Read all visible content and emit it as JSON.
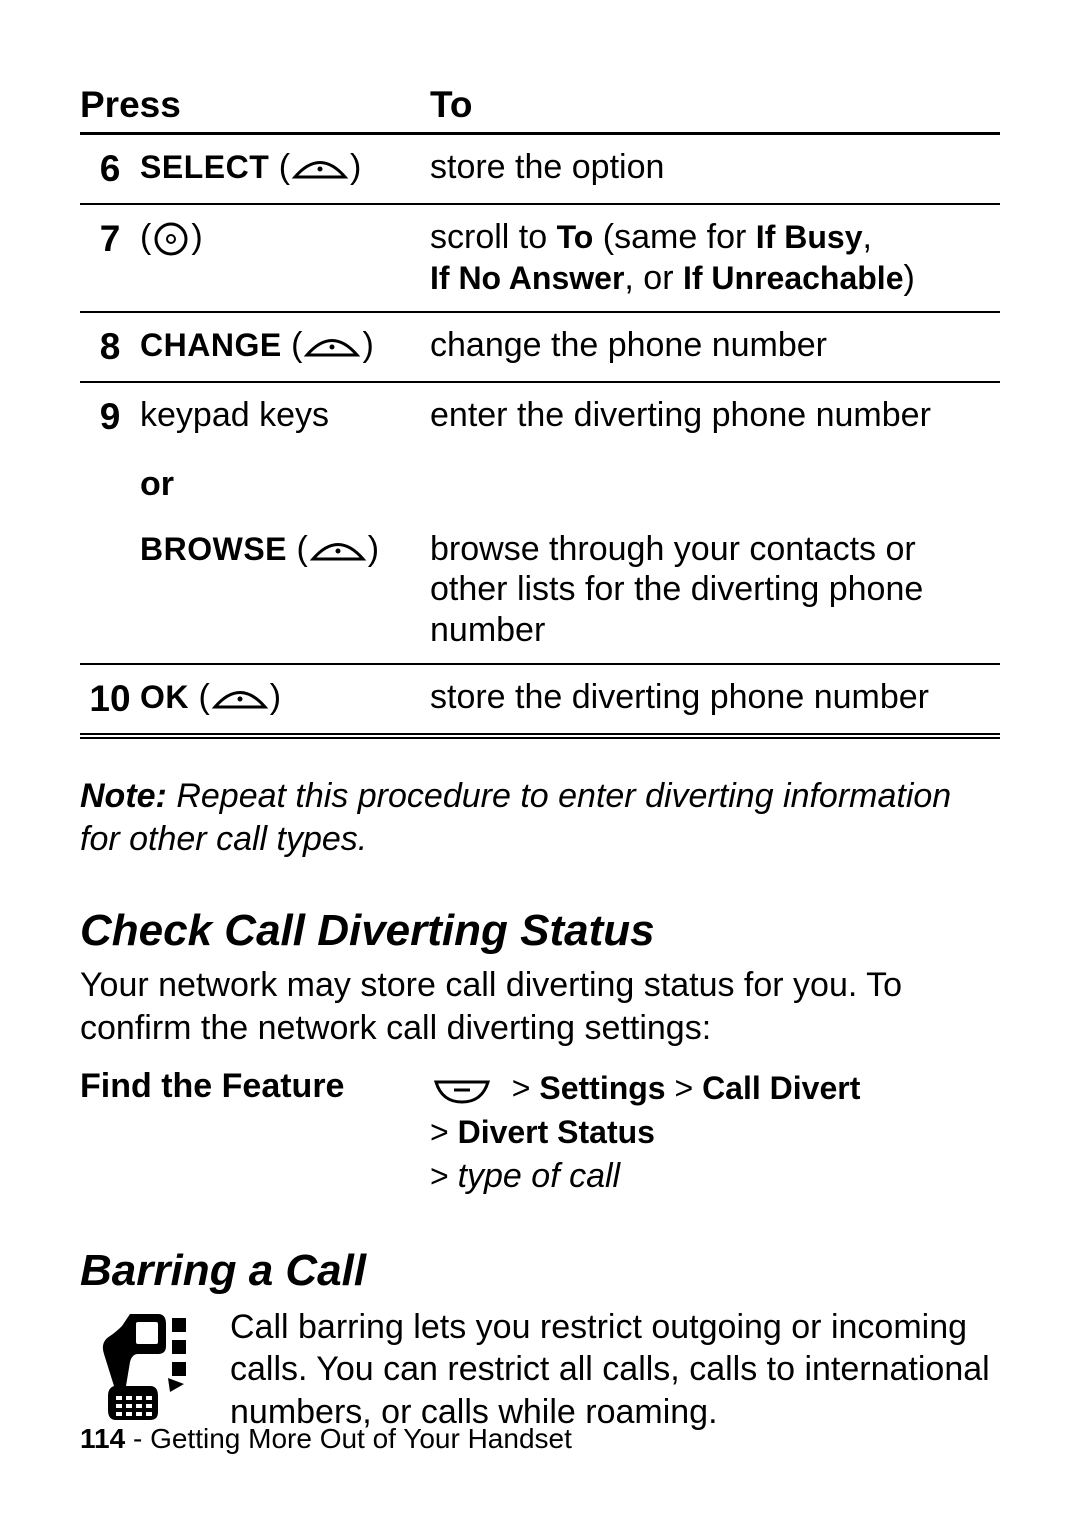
{
  "table": {
    "head_press": "Press",
    "head_to": "To",
    "rows": {
      "r6": {
        "num": "6",
        "press_label": "SELECT",
        "to": "store the option"
      },
      "r7": {
        "num": "7",
        "to_pre": "scroll to ",
        "to_bold1": "To",
        "to_mid1": " (same for ",
        "to_bold2": "If Busy",
        "to_mid2": ", ",
        "to_bold3": "If No Answer",
        "to_mid3": ", or ",
        "to_bold4": "If Unreachable",
        "to_post": ")"
      },
      "r8": {
        "num": "8",
        "press_label": "CHANGE",
        "to": "change the phone number"
      },
      "r9a": {
        "num": "9",
        "press_label": "keypad keys",
        "to": "enter the diverting phone number"
      },
      "r9or": {
        "or": "or"
      },
      "r9b": {
        "press_label": "BROWSE",
        "to": "browse through your contacts or other lists for the diverting phone number"
      },
      "r10": {
        "num": "10",
        "press_label": "OK",
        "to": "store the diverting phone number"
      }
    }
  },
  "note": {
    "lead": "Note:",
    "rest": " Repeat this procedure to enter diverting information for other call types."
  },
  "sec_check": {
    "title": "Check Call Diverting Status",
    "para": "Your network may store call diverting status for you. To confirm the network call diverting settings:"
  },
  "ftf": {
    "label": "Find the Feature",
    "gt": ">",
    "s1": "Settings",
    "s2": "Call Divert",
    "s3": "Divert Status",
    "s4": "type of call"
  },
  "sec_barring": {
    "title": "Barring a Call",
    "para": "Call barring lets you restrict outgoing or incoming calls. You can restrict all calls, calls to international numbers, or calls while roaming."
  },
  "footer": {
    "page": "114",
    "sep": " - ",
    "chapter": "Getting More Out of Your Handset"
  }
}
